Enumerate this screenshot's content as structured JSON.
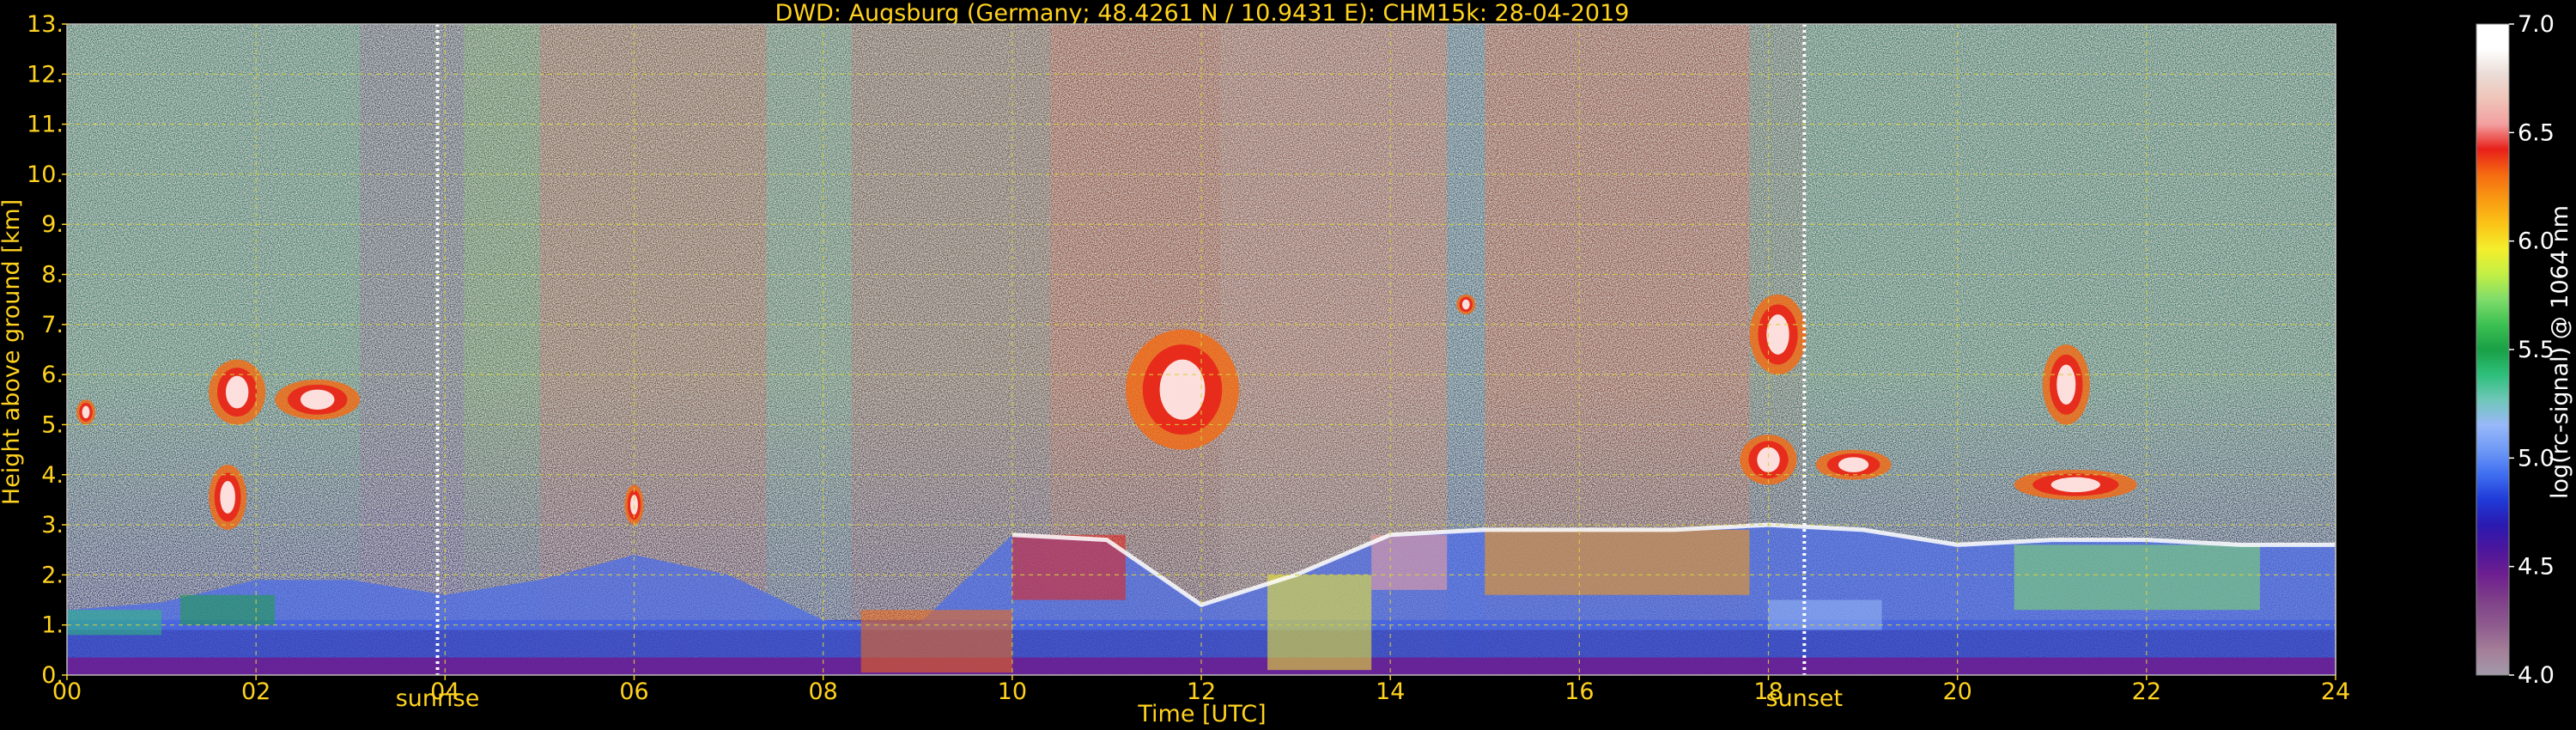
{
  "chart_data": {
    "type": "heatmap",
    "title": "DWD: Augsburg (Germany; 48.4261 N / 10.9431 E):    CHM15k: 28-04-2019",
    "xlabel": "Time [UTC]",
    "ylabel": "Height above ground [km]",
    "xlim": [
      0,
      24
    ],
    "ylim": [
      0,
      13
    ],
    "x_ticks": [
      "00",
      "02",
      "04",
      "06",
      "08",
      "10",
      "12",
      "14",
      "16",
      "18",
      "20",
      "22",
      "24"
    ],
    "y_ticks": [
      "0.",
      "1.",
      "2.",
      "3.",
      "4.",
      "5.",
      "6.",
      "7.",
      "8.",
      "9.",
      "10.",
      "11.",
      "12.",
      "13."
    ],
    "grid": true,
    "markers": [
      {
        "label": "sunrise",
        "time": 3.92
      },
      {
        "label": "sunset",
        "time": 18.38
      }
    ],
    "colorbar": {
      "label": "log(rc-signal) @ 1064 nm",
      "range": [
        4.0,
        7.0
      ],
      "ticks": [
        "4.0",
        "4.5",
        "5.0",
        "5.5",
        "6.0",
        "6.5",
        "7.0"
      ],
      "colors": [
        "#a39aaa",
        "#a47e98",
        "#8e5b8e",
        "#7e3f88",
        "#6e1f90",
        "#4c169c",
        "#2a1ab0",
        "#1f3ad8",
        "#3f6ef0",
        "#6f9af6",
        "#98b8f8",
        "#6fc7b8",
        "#2dbf7a",
        "#1aa046",
        "#3cc152",
        "#7fdc6a",
        "#c2ef45",
        "#f4ef2c",
        "#fbc417",
        "#f99a12",
        "#f56a11",
        "#e8201a",
        "#f2a0a0",
        "#f0c4b8",
        "#eadcd6",
        "#ffffff",
        "#ffffff"
      ]
    },
    "layers": [
      {
        "name": "boundary layer top",
        "height_km_approx": "1.0-2.8"
      },
      {
        "name": "cloud layers",
        "height_km_approx": "3.0-7.5"
      }
    ]
  }
}
